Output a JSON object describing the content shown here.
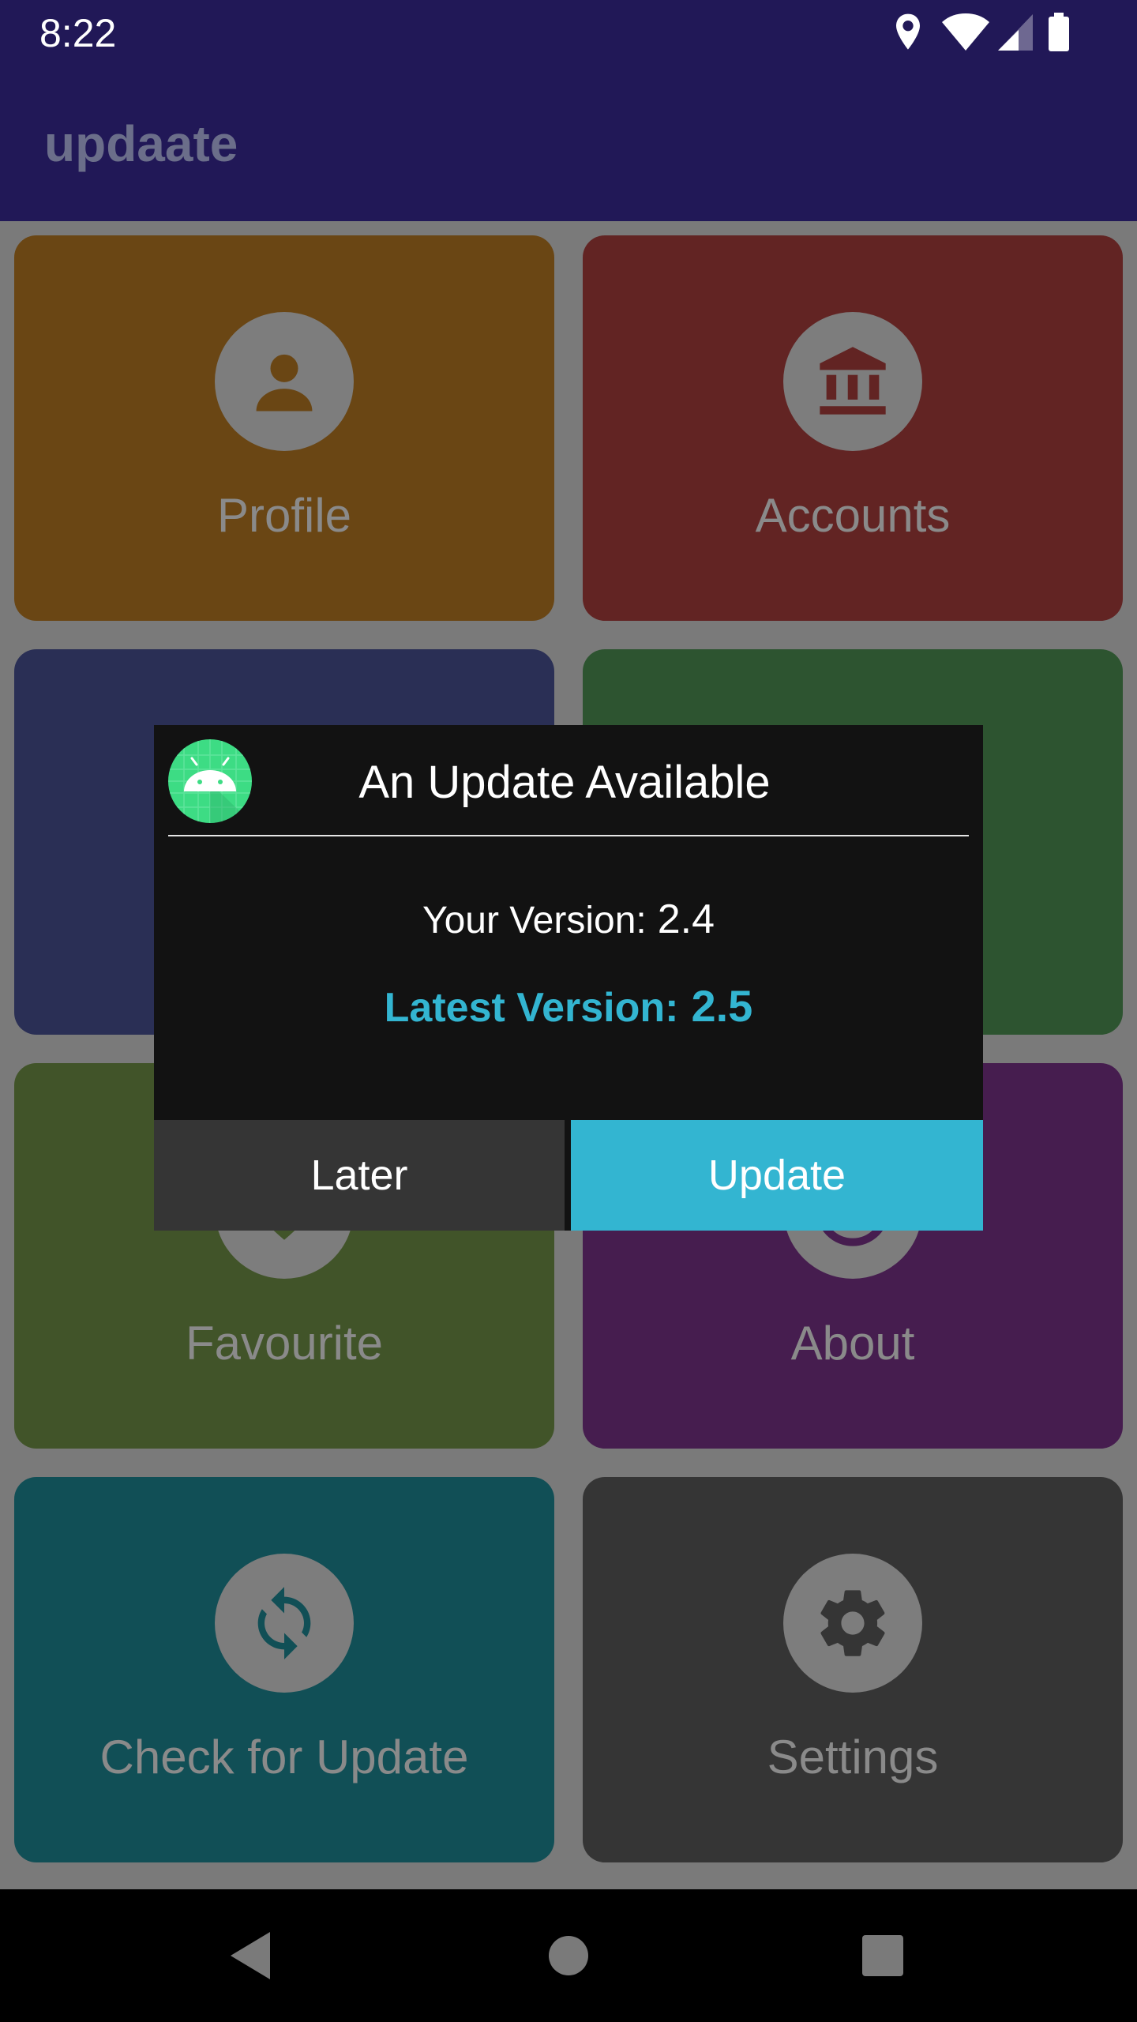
{
  "status_bar": {
    "time": "8:22",
    "icons": [
      "location-icon",
      "wifi-icon",
      "signal-icon",
      "battery-icon"
    ]
  },
  "app_bar": {
    "title": "updaate"
  },
  "tiles": [
    {
      "label": "Profile",
      "icon": "person-icon",
      "color": "#6a4614"
    },
    {
      "label": "Accounts",
      "icon": "bank-icon",
      "color": "#622423"
    },
    {
      "label": "",
      "icon": "",
      "color": "#2a2f55"
    },
    {
      "label": "",
      "icon": "",
      "color": "#2d5430"
    },
    {
      "label": "Favourite",
      "icon": "favourite-icon",
      "color": "#415429"
    },
    {
      "label": "About",
      "icon": "info-icon",
      "color": "#461d4f"
    },
    {
      "label": "Check for Update",
      "icon": "sync-icon",
      "color": "#114f56"
    },
    {
      "label": "Settings",
      "icon": "gear-icon",
      "color": "#353535"
    }
  ],
  "dialog": {
    "title": "An Update Available",
    "your_version_label": "Your Version:",
    "your_version_value": "2.4",
    "latest_version_label": "Latest Version:",
    "latest_version_value": "2.5",
    "later_label": "Later",
    "update_label": "Update",
    "accent_color": "#33b5d1"
  },
  "nav_bar": {
    "buttons": [
      "back-icon",
      "home-icon",
      "recents-icon"
    ]
  }
}
